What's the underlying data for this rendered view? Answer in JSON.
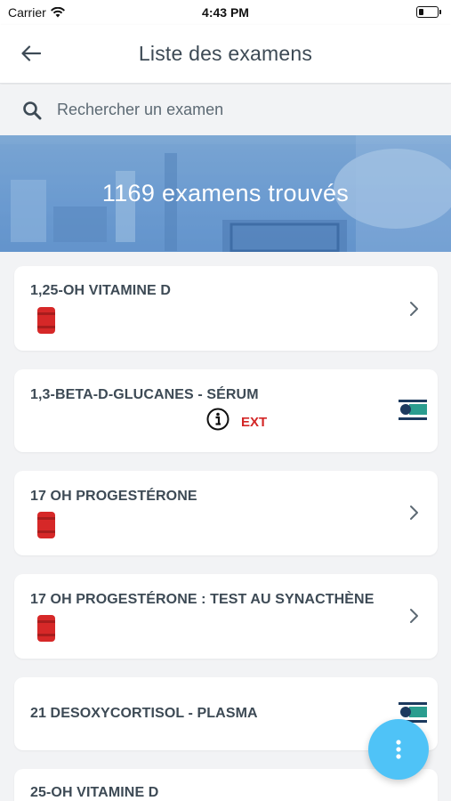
{
  "status_bar": {
    "carrier": "Carrier",
    "time": "4:43 PM",
    "battery_level": 0.3
  },
  "header": {
    "title": "Liste des examens",
    "back_icon": "arrow-left-icon"
  },
  "search": {
    "placeholder": "Rechercher un examen",
    "value": ""
  },
  "banner": {
    "text": "1169 examens trouvés"
  },
  "exams": [
    {
      "name": "1,25-OH VITAMINE D",
      "tube": true,
      "ext": false,
      "chevron": true
    },
    {
      "name": "1,3-BETA-D-GLUCANES - SÉRUM",
      "tube": false,
      "ext": true,
      "ext_label": "EXT",
      "chevron": false
    },
    {
      "name": "17 OH PROGESTÉRONE",
      "tube": true,
      "ext": false,
      "chevron": true
    },
    {
      "name": "17 OH PROGESTÉRONE : TEST AU SYNACTHÈNE",
      "tube": true,
      "ext": false,
      "chevron": true
    },
    {
      "name": "21 DESOXYCORTISOL - PLASMA",
      "tube": false,
      "ext": false,
      "ext_logo": true,
      "chevron": false
    },
    {
      "name": "25-OH VITAMINE D",
      "tube": false,
      "ext": false,
      "chevron": false
    }
  ],
  "colors": {
    "tube_red": "#d62828",
    "ext_red": "#d32626",
    "fab_blue": "#4fc3f7",
    "logo_navy": "#1c3a5e",
    "logo_teal": "#2a9d8f"
  }
}
